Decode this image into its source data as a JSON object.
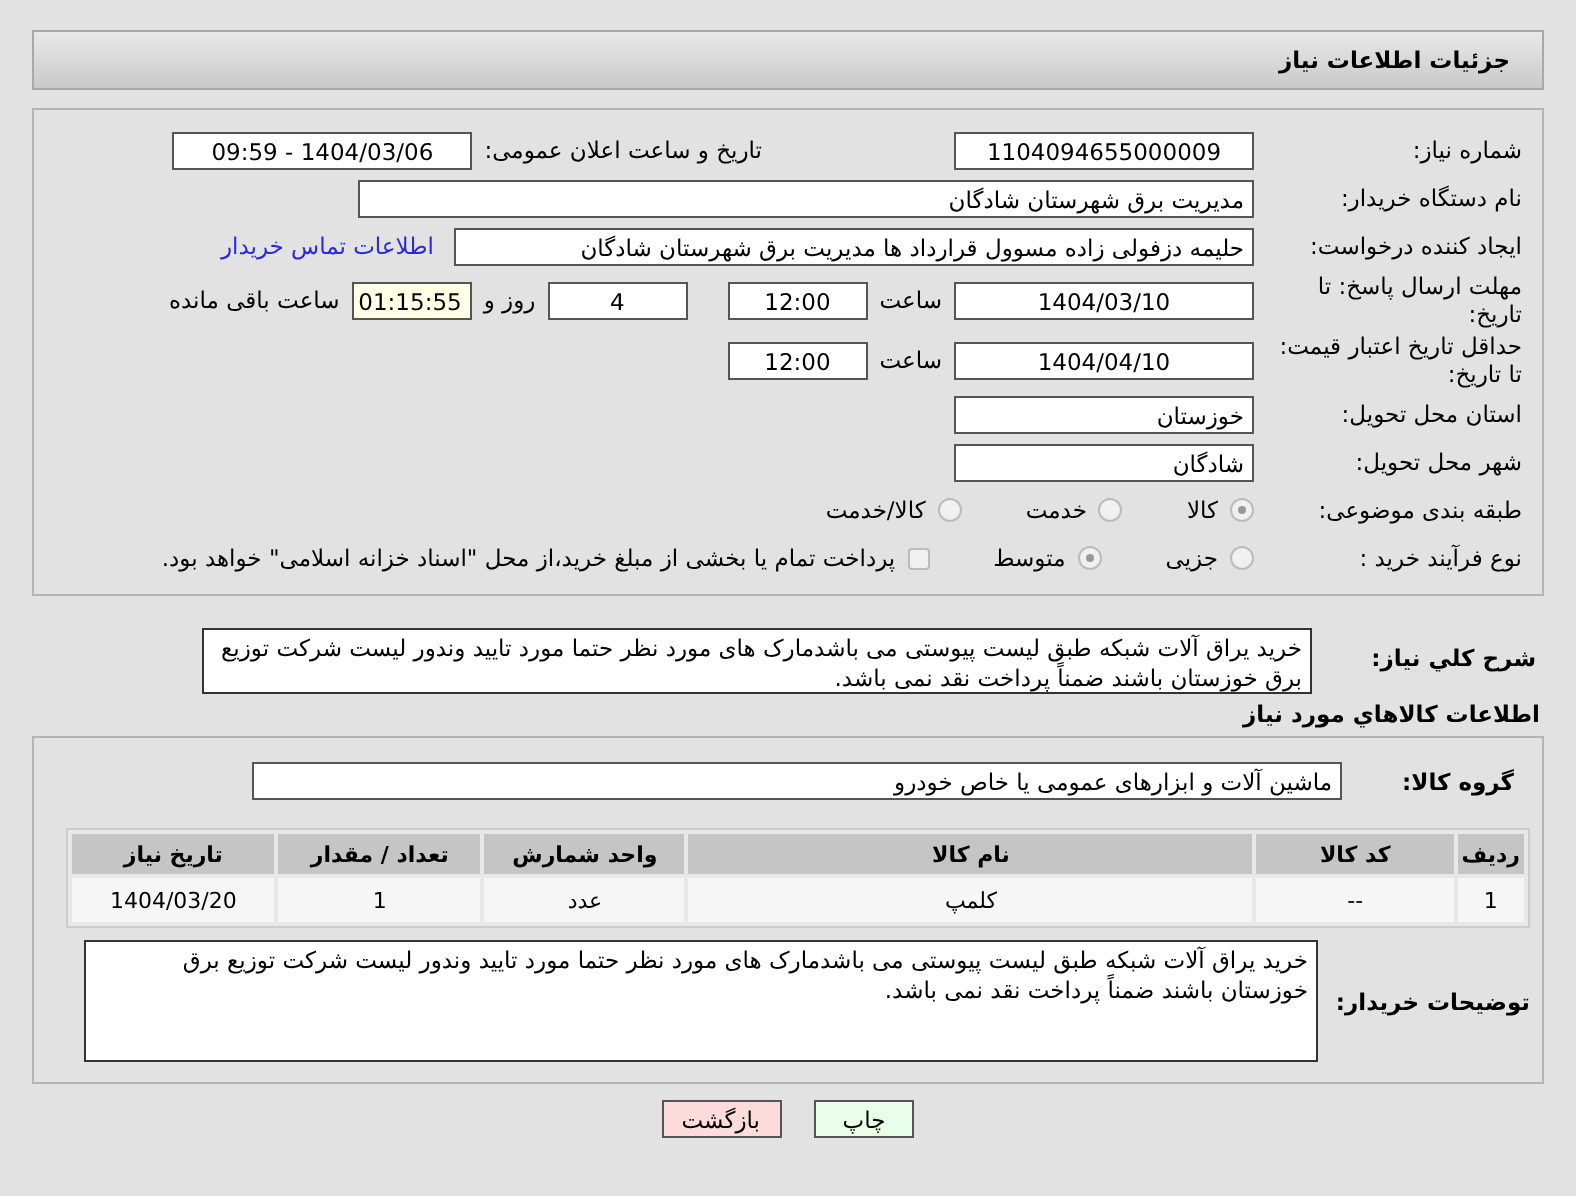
{
  "header": {
    "title": "جزئیات اطلاعات نیاز"
  },
  "need_number": {
    "label": "شماره نیاز:",
    "value": "1104094655000009"
  },
  "announce_datetime": {
    "label": "تاریخ و ساعت اعلان عمومی:",
    "value": "1404/03/06 - 09:59"
  },
  "buyer_org": {
    "label": "نام دستگاه خریدار:",
    "value": "مدیریت برق شهرستان شادگان"
  },
  "requester": {
    "label": "ایجاد کننده درخواست:",
    "value": "حلیمه دزفولی زاده مسوول قرارداد ها مدیریت برق شهرستان شادگان",
    "contact_link": "اطلاعات تماس خریدار"
  },
  "response_deadline": {
    "label": "مهلت ارسال پاسخ: تا تاریخ:",
    "date": "1404/03/10",
    "time_label": "ساعت",
    "time": "12:00",
    "days": "4",
    "days_label": "روز و",
    "remaining": "01:15:55",
    "remaining_label": "ساعت باقی مانده"
  },
  "price_validity": {
    "label": "حداقل تاریخ اعتبار قیمت: تا تاریخ:",
    "date": "1404/04/10",
    "time_label": "ساعت",
    "time": "12:00"
  },
  "delivery_province": {
    "label": "استان محل تحویل:",
    "value": "خوزستان"
  },
  "delivery_city": {
    "label": "شهر محل تحویل:",
    "value": "شادگان"
  },
  "category": {
    "label": "طبقه بندی موضوعی:",
    "options": [
      {
        "label": "کالا",
        "selected": true
      },
      {
        "label": "خدمت",
        "selected": false
      },
      {
        "label": "کالا/خدمت",
        "selected": false
      }
    ]
  },
  "purchase_process": {
    "label": "نوع فرآیند خرید :",
    "options": [
      {
        "label": "جزیی",
        "selected": false
      },
      {
        "label": "متوسط",
        "selected": true
      }
    ],
    "payment_note": {
      "checked": false,
      "text": "پرداخت تمام یا بخشی از مبلغ خرید،از محل \"اسناد خزانه اسلامی\" خواهد بود."
    }
  },
  "description": {
    "label": "شرح کلي نیاز:",
    "value": "خرید یراق آلات شبکه طبق لیست پیوستی می باشدمارک های  مورد نظر حتما مورد تایید وندور لیست  شرکت توزیع برق خوزستان باشند ضمناً پرداخت نقد نمی باشد."
  },
  "goods": {
    "title": "اطلاعات کالاهاي مورد نیاز",
    "group": {
      "label": "گروه کالا:",
      "value": "ماشین آلات و ابزارهای عمومی یا خاص خودرو"
    },
    "table": {
      "columns": [
        "ردیف",
        "کد کالا",
        "نام کالا",
        "واحد شمارش",
        "تعداد / مقدار",
        "تاریخ نیاز"
      ],
      "rows": [
        [
          "1",
          "--",
          "کلمپ",
          "عدد",
          "1",
          "1404/03/20"
        ]
      ]
    },
    "buyer_notes": {
      "label": "توضیحات خریدار:",
      "value": "خرید یراق آلات شبکه طبق لیست پیوستی می باشدمارک های  مورد نظر حتما مورد تایید وندور لیست  شرکت توزیع برق خوزستان باشند ضمناً پرداخت نقد نمی باشد."
    }
  },
  "buttons": [
    {
      "label": "چاپ",
      "kind": "print"
    },
    {
      "label": "بازگشت",
      "kind": "back"
    }
  ]
}
